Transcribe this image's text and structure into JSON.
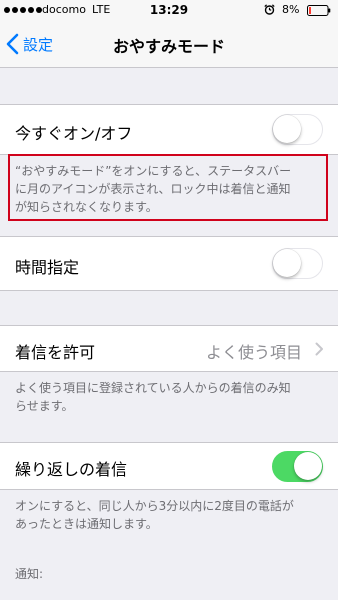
{
  "status_bar": {
    "carrier": "docomo",
    "network": "LTE",
    "time": "13:29",
    "battery": "8%",
    "icons": [
      "signal-dots-icon",
      "alarm-icon",
      "battery-icon"
    ]
  },
  "nav": {
    "back_label": "設定",
    "title": "おやすみモード"
  },
  "settings": {
    "manual": {
      "label": "今すぐオン/オフ",
      "enabled": false,
      "description_line1": "“おやすみモード”をオンにすると、ステータスバー",
      "description_line2": "に月のアイコンが表示され、ロック中は着信と通知",
      "description_line3": "が知らされなくなります。"
    },
    "scheduled": {
      "label": "時間指定",
      "enabled": false
    },
    "allow_calls": {
      "label": "着信を許可",
      "value": "よく使う項目",
      "description_line1": "よく使う項目に登録されている人からの着信のみ知",
      "description_line2": "らせます。"
    },
    "repeated_calls": {
      "label": "繰り返しの着信",
      "enabled": true,
      "description_line1": "オンにすると、同じ人から3分以内に2度目の電話が",
      "description_line2": "あったときは通知します。"
    },
    "notifications_header": "通知:"
  },
  "colors": {
    "accent": "#007aff",
    "switch_on": "#4cd964",
    "highlight": "#d0021b",
    "background": "#efeff4"
  }
}
